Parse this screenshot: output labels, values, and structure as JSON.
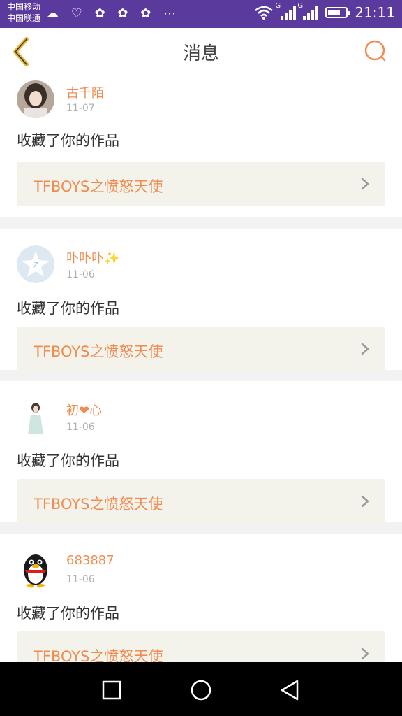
{
  "status_bar": {
    "carrier1": "中国移动",
    "carrier2": "中国联通",
    "notif_icons": "☁ ♡ ✿ ✿ ✿ ⋯",
    "time": "21:11",
    "battery_level": 0.75,
    "signal_label": "G"
  },
  "header": {
    "title": "消息",
    "back_icon": "chevron-left-icon",
    "search_icon": "search-icon",
    "accent_color": "#f08c4f",
    "back_color": "#e8b43a"
  },
  "feed": {
    "items": [
      {
        "username": "古千陌",
        "date": "11-07",
        "action": "收藏了你的作品",
        "work_title": "TFBOYS之愤怒天使",
        "avatar": "avatar-girl-photo"
      },
      {
        "username": "卟卟卟✨",
        "date": "11-06",
        "action": "收藏了你的作品",
        "work_title": "TFBOYS之愤怒天使",
        "avatar": "avatar-qzone-star"
      },
      {
        "username": "初❤心",
        "date": "11-06",
        "action": "收藏了你的作品",
        "work_title": "TFBOYS之愤怒天使",
        "avatar": "avatar-girl-white-dress"
      },
      {
        "username": "683887",
        "date": "11-06",
        "action": "收藏了你的作品",
        "work_title": "TFBOYS之愤怒天使",
        "avatar": "avatar-qq-penguin"
      }
    ]
  },
  "nav_bar": {
    "recents_icon": "square-icon",
    "home_icon": "circle-icon",
    "back_icon": "triangle-back-icon"
  }
}
